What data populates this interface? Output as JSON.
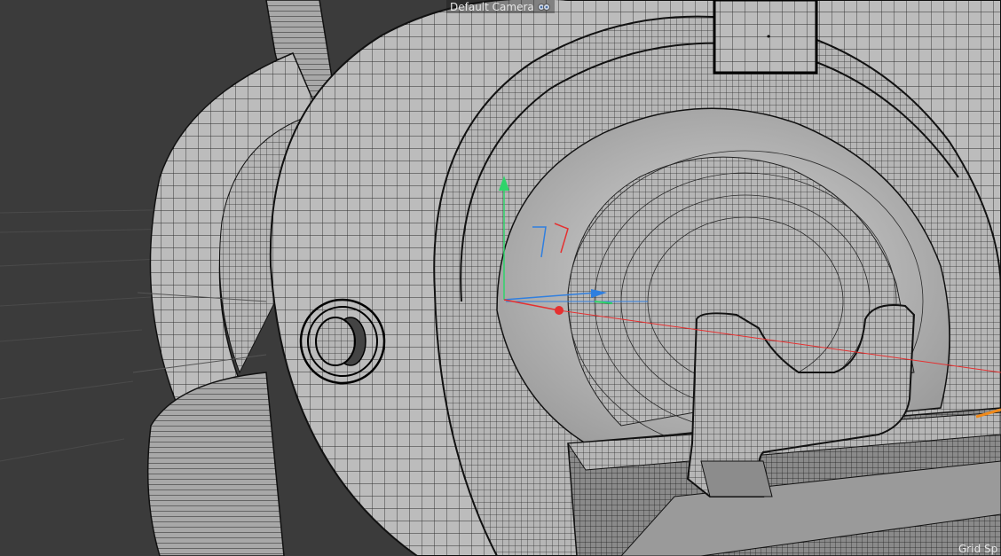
{
  "viewport": {
    "camera_label": "Default Camera",
    "camera_icon": "camera-icon",
    "grid_label": "Grid Sp",
    "colors": {
      "background": "#3b3b3b",
      "mesh_fill": "#bdbdbd",
      "mesh_wire": "#2a2a2a",
      "axis_x": "#e53030",
      "axis_y": "#2fd46a",
      "axis_z": "#2f7fe0",
      "selection_accent": "#f08a1a"
    }
  }
}
